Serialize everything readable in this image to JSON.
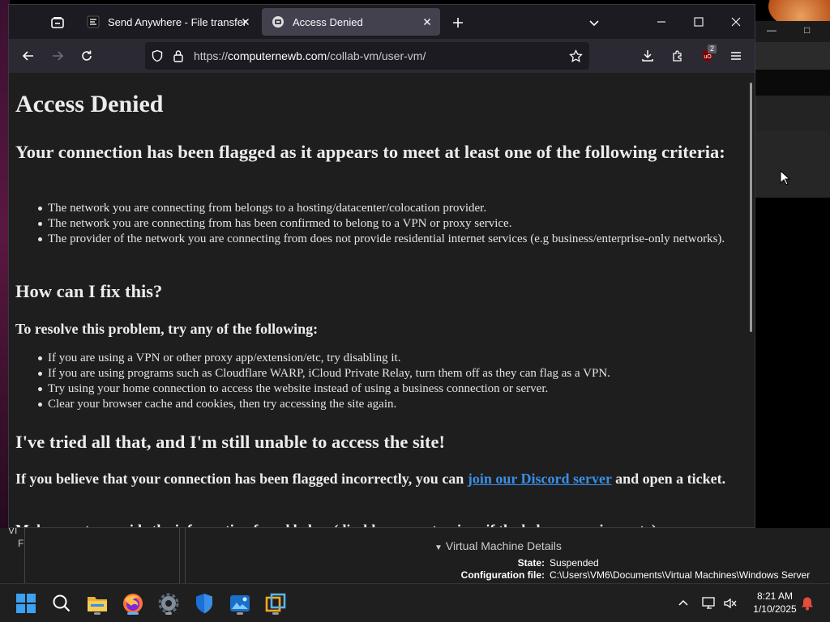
{
  "browser": {
    "tabs": [
      {
        "title": "Send Anywhere - File transfer",
        "active": false
      },
      {
        "title": "Access Denied",
        "active": true
      }
    ],
    "url_scheme": "https://",
    "url_host": "computernewb.com",
    "url_path": "/collab-vm/user-vm/",
    "extension_badge": "2"
  },
  "page": {
    "title": "Access Denied",
    "heading_flagged": "Your connection has been flagged as it appears to meet at least one of the following criteria:",
    "criteria": [
      "The network you are connecting from belongs to a hosting/datacenter/colocation provider.",
      "The network you are connecting from has been confirmed to belong to a VPN or proxy service.",
      "The provider of the network you are connecting from does not provide residential internet services (e.g business/enterprise-only networks)."
    ],
    "heading_fix": "How can I fix this?",
    "resolve_intro": "To resolve this problem, try any of the following:",
    "fixes": [
      "If you are using a VPN or other proxy app/extension/etc, try disabling it.",
      "If you are using programs such as Cloudflare WARP, iCloud Private Relay, turn them off as they can flag as a VPN.",
      "Try using your home connection to access the website instead of using a business connection or server.",
      "Clear your browser cache and cookies, then try accessing the site again."
    ],
    "heading_tried": "I've tried all that, and I'm still unable to access the site!",
    "believe_pre": "If you believe that your connection has been flagged incorrectly, you can ",
    "discord_link": "join our Discord server",
    "believe_post": " and open a ticket.",
    "make_sure": "Make sure to provide the information found below (disable your extensions if the below space is empty):"
  },
  "vmware": {
    "side_label_1": "VI",
    "side_label_2": "F",
    "details_header": "Virtual Machine Details",
    "state_label": "State:",
    "state_value": "Suspended",
    "config_label": "Configuration file:",
    "config_value": "C:\\Users\\VM6\\Documents\\Virtual Machines\\Windows Server"
  },
  "taskbar": {
    "time": "8:21 AM",
    "date": "1/10/2025",
    "apps": [
      "start-icon",
      "search-icon",
      "file-explorer-icon",
      "firefox-icon",
      "settings-icon",
      "windows-security-icon",
      "photos-icon",
      "vmware-icon"
    ]
  },
  "colors": {
    "link": "#3a8ee6",
    "page_bg": "#1e1e1e",
    "tab_active": "#42414d",
    "toolbar": "#2b2a33"
  }
}
